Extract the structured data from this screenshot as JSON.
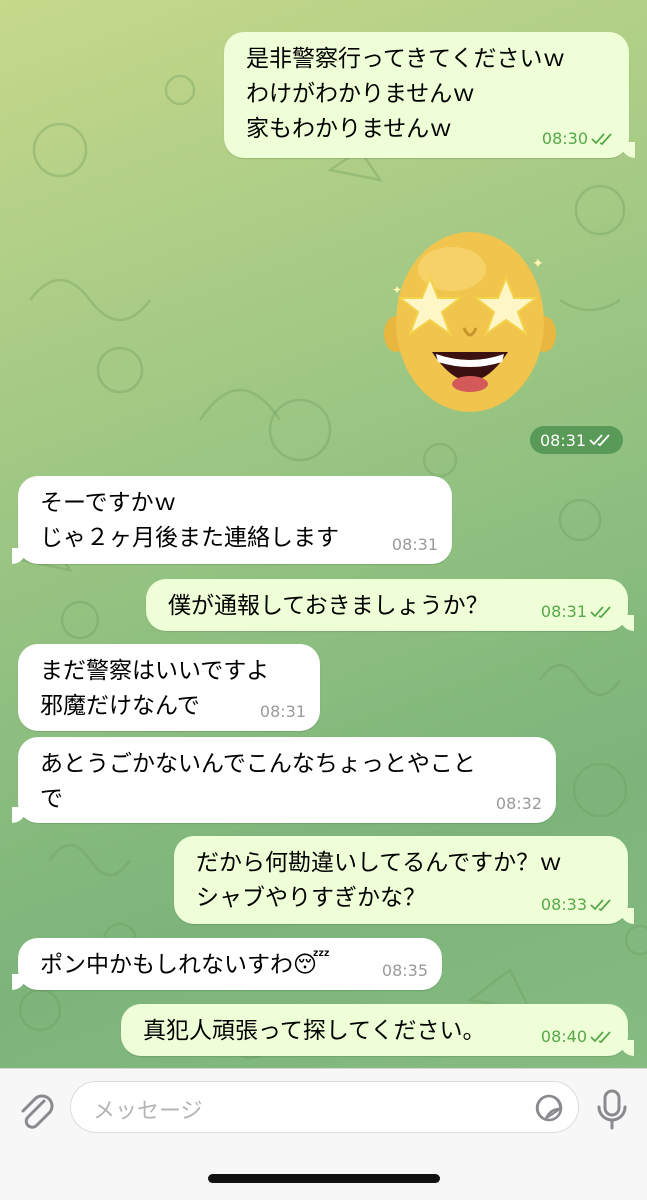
{
  "messages": [
    {
      "id": 1,
      "dir": "out",
      "text": "是非警察行ってきてくださいｗ\nわけがわかりませんｗ\n家もわかりませんｗ",
      "time": "08:30",
      "read": true
    },
    {
      "id": 2,
      "dir": "out",
      "type": "sticker",
      "sticker": "star-eyes-memoji",
      "time": "08:31",
      "read": true
    },
    {
      "id": 3,
      "dir": "in",
      "text": "そーですかｗ\nじゃ２ヶ月後また連絡します",
      "time": "08:31"
    },
    {
      "id": 4,
      "dir": "out",
      "text": "僕が通報しておきましょうか？",
      "time": "08:31",
      "read": true
    },
    {
      "id": 5,
      "dir": "in",
      "text": "まだ警察はいいですよ\n邪魔だけなんで",
      "time": "08:31"
    },
    {
      "id": 6,
      "dir": "in",
      "text": "あとうごかないんでこんなちょっとやこと\nで",
      "time": "08:32"
    },
    {
      "id": 7,
      "dir": "out",
      "text": "だから何勘違いしてるんですか？ｗ\nシャブやりすぎかな？",
      "time": "08:33",
      "read": true
    },
    {
      "id": 8,
      "dir": "in",
      "text": "ポン中かもしれないすわ",
      "emoji": "😴",
      "time": "08:35"
    },
    {
      "id": 9,
      "dir": "out",
      "text": "真犯人頑張って探してください。",
      "time": "08:40",
      "read": true
    }
  ],
  "input": {
    "placeholder": "メッセージ"
  },
  "icons": {
    "attach": "paperclip-icon",
    "sticker": "sticker-icon",
    "mic": "microphone-icon",
    "read": "double-check-icon"
  },
  "colors": {
    "outgoing_bubble": "#eefed6",
    "incoming_bubble": "#ffffff",
    "read_tick": "#57a849",
    "wallpaper": "#8ebf80"
  }
}
